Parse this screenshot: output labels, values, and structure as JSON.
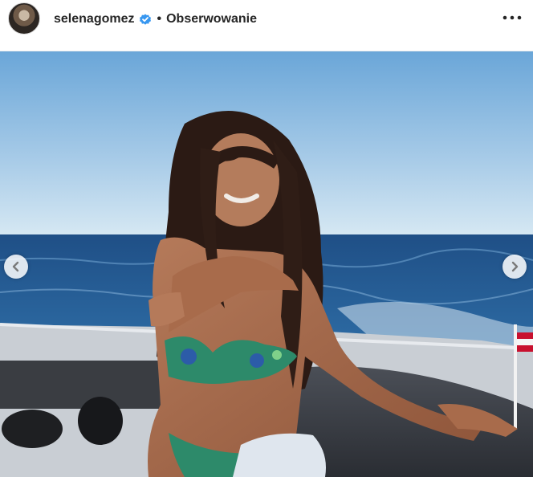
{
  "post": {
    "username": "selenagomez",
    "separator": "•",
    "follow_label": "Obserwowanie"
  },
  "icons": {
    "verified": "verified-badge-icon",
    "more": "more-options-icon",
    "prev": "chevron-left-icon",
    "next": "chevron-right-icon"
  },
  "colors": {
    "verified_blue": "#3897f0",
    "text": "#262626"
  }
}
